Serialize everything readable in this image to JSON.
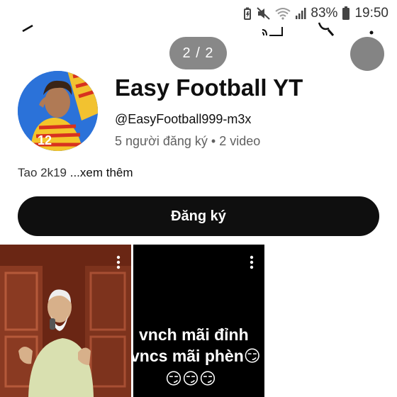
{
  "status_bar": {
    "battery": "83%",
    "time": "19:50"
  },
  "overlay": {
    "page_indicator": "2 / 2"
  },
  "channel": {
    "name": "Easy Football YT",
    "handle": "@EasyFootball999-m3x",
    "stats": "5 người đăng ký • 2 video",
    "description": "Tao 2k19",
    "description_more": " ...xem thêm",
    "subscribe_label": "Đăng ký"
  },
  "shorts": [
    {
      "caption": ""
    },
    {
      "caption_line1": "vnch mãi đỉnh",
      "caption_line2": "vncs mãi phèn😏",
      "caption_line3": "😏😏😏"
    }
  ],
  "icons": {
    "status": [
      "battery-saver-icon",
      "mute-icon",
      "wifi-icon",
      "signal-icon",
      "battery-icon"
    ],
    "app_bar": [
      "back-arrow-icon",
      "cast-icon",
      "search-icon",
      "more-vert-icon"
    ]
  }
}
